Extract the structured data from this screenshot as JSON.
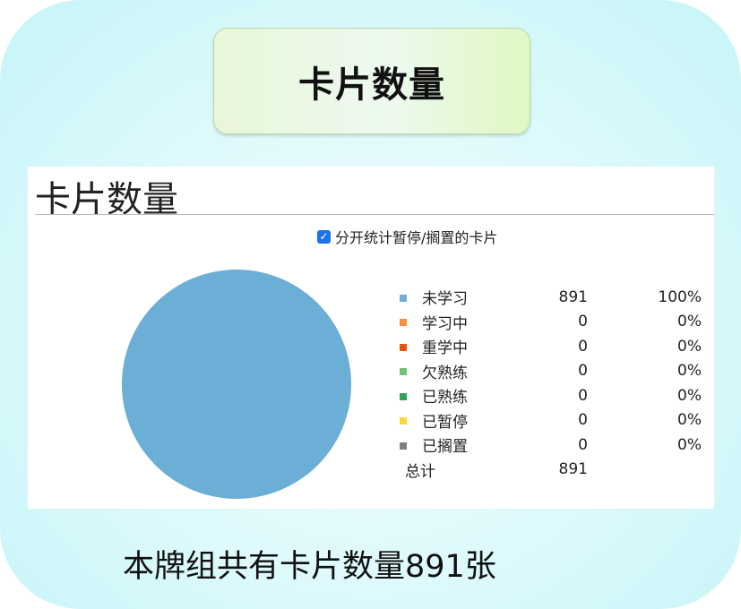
{
  "banner": {
    "title": "卡片数量"
  },
  "panel": {
    "title": "卡片数量",
    "checkbox": {
      "label": "分开统计暂停/搁置的卡片",
      "checked": true
    }
  },
  "colors": {
    "accent": "#1a73e8",
    "card_bg": "#c6f5f8"
  },
  "chart_data": {
    "type": "pie",
    "title": "卡片数量",
    "slices": [
      {
        "name": "未学习",
        "value": 891,
        "percent": "100%",
        "color": "#6baed6"
      },
      {
        "name": "学习中",
        "value": 0,
        "percent": "0%",
        "color": "#fd8d3c"
      },
      {
        "name": "重学中",
        "value": 0,
        "percent": "0%",
        "color": "#e6550d"
      },
      {
        "name": "欠熟练",
        "value": 0,
        "percent": "0%",
        "color": "#74c476"
      },
      {
        "name": "已熟练",
        "value": 0,
        "percent": "0%",
        "color": "#31a354"
      },
      {
        "name": "已暂停",
        "value": 0,
        "percent": "0%",
        "color": "#ffd92f"
      },
      {
        "name": "已搁置",
        "value": 0,
        "percent": "0%",
        "color": "#7f7f7f"
      }
    ],
    "total": {
      "label": "总计",
      "value": 891
    }
  },
  "footer": {
    "text": "本牌组共有卡片数量891张"
  }
}
